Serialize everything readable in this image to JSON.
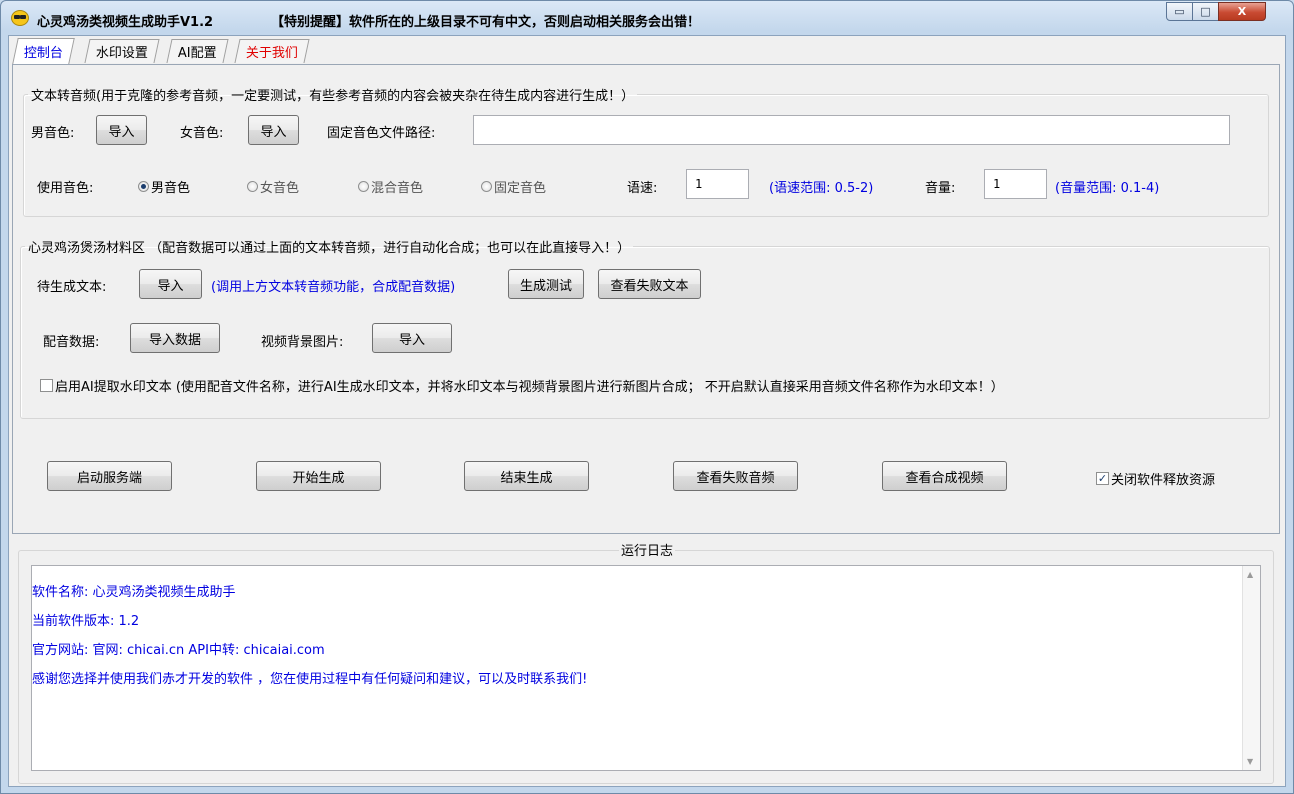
{
  "window": {
    "title": "心灵鸡汤类视频生成助手V1.2",
    "notice": "【特别提醒】软件所在的上级目录不可有中文，否则启动相关服务会出错！",
    "controls": {
      "minimize": "▭",
      "maximize": "□",
      "close": "X"
    }
  },
  "tabs": [
    {
      "label": "控制台",
      "active": true,
      "color": "#0000e0"
    },
    {
      "label": "水印设置",
      "active": false,
      "color": "#000000"
    },
    {
      "label": "AI配置",
      "active": false,
      "color": "#000000"
    },
    {
      "label": "关于我们",
      "active": false,
      "color": "#e00000"
    }
  ],
  "tts_group": {
    "legend": "文本转音频(用于克隆的参考音频，一定要测试，有些参考音频的内容会被夹杂在待生成内容进行生成！）",
    "male_label": "男音色:",
    "male_import": "导入",
    "female_label": "女音色:",
    "female_import": "导入",
    "fixed_path_label": "固定音色文件路径:",
    "fixed_path_value": "",
    "use_voice_label": "使用音色:",
    "radios": [
      {
        "label": "男音色",
        "checked": true
      },
      {
        "label": "女音色",
        "checked": false
      },
      {
        "label": "混合音色",
        "checked": false
      },
      {
        "label": "固定音色",
        "checked": false
      }
    ],
    "speed_label": "语速:",
    "speed_value": "1",
    "speed_range": "(语速范围: 0.5-2)",
    "volume_label": "音量:",
    "volume_value": "1",
    "volume_range": "(音量范围: 0.1-4)"
  },
  "material_group": {
    "legend": "心灵鸡汤煲汤材料区 （配音数据可以通过上面的文本转音频，进行自动化合成；也可以在此直接导入！）",
    "pending_label": "待生成文本:",
    "pending_import": "导入",
    "pending_hint": "(调用上方文本转音频功能，合成配音数据)",
    "gen_test": "生成测试",
    "view_failed_text": "查看失败文本",
    "dub_label": "配音数据:",
    "dub_import": "导入数据",
    "bg_label": "视频背景图片:",
    "bg_import": "导入",
    "ai_checkbox_label": "启用AI提取水印文本 (使用配音文件名称，进行AI生成水印文本，并将水印文本与视频背景图片进行新图片合成； 不开启默认直接采用音频文件名称作为水印文本！）",
    "ai_checked": false
  },
  "actions": {
    "start_server": "启动服务端",
    "start_gen": "开始生成",
    "stop_gen": "结束生成",
    "view_failed_audio": "查看失败音频",
    "view_video": "查看合成视频",
    "release_label": "关闭软件释放资源",
    "release_checked": true
  },
  "log": {
    "title": "运行日志",
    "lines": [
      "软件名称: 心灵鸡汤类视频生成助手",
      "当前软件版本: 1.2",
      "官方网站: 官网: chicai.cn  API中转: chicaiai.com",
      "感谢您选择并使用我们赤才开发的软件 ，您在使用过程中有任何疑问和建议，可以及时联系我们!"
    ]
  },
  "icons": {
    "app": "sunglasses-face-icon",
    "scroll_up": "▲",
    "scroll_down": "▼"
  }
}
